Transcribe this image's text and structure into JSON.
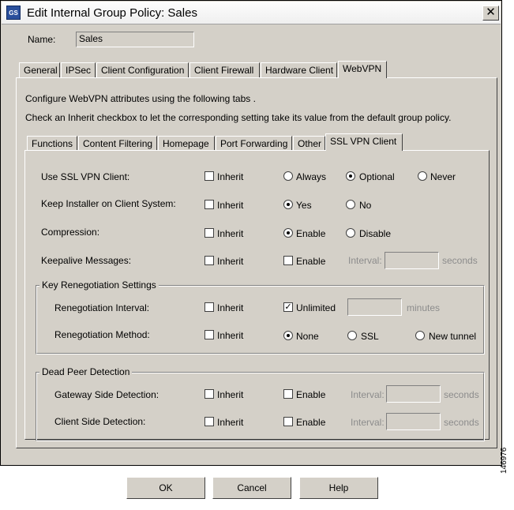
{
  "window": {
    "title": "Edit Internal Group Policy: Sales",
    "app_icon_text": "GS",
    "close_symbol": "✕"
  },
  "name_field": {
    "label": "Name:",
    "value": "Sales"
  },
  "main_tabs": [
    {
      "label": "General"
    },
    {
      "label": "IPSec"
    },
    {
      "label": "Client Configuration"
    },
    {
      "label": "Client Firewall"
    },
    {
      "label": "Hardware Client"
    },
    {
      "label": "WebVPN",
      "active": true
    }
  ],
  "description": {
    "line1": "Configure WebVPN attributes using the following tabs .",
    "line2": "Check an Inherit checkbox to let the corresponding setting take its value from the default group policy."
  },
  "sub_tabs": [
    {
      "label": "Functions"
    },
    {
      "label": "Content Filtering"
    },
    {
      "label": "Homepage"
    },
    {
      "label": "Port Forwarding"
    },
    {
      "label": "Other"
    },
    {
      "label": "SSL VPN Client",
      "active": true
    }
  ],
  "inherit_label": "Inherit",
  "settings": {
    "use_ssl_vpn_client": {
      "label": "Use SSL VPN Client:",
      "inherit": false,
      "options": [
        "Always",
        "Optional",
        "Never"
      ],
      "selected": "Optional"
    },
    "keep_installer": {
      "label": "Keep Installer on Client System:",
      "inherit": false,
      "options": [
        "Yes",
        "No"
      ],
      "selected": "Yes"
    },
    "compression": {
      "label": "Compression:",
      "inherit": false,
      "options": [
        "Enable",
        "Disable"
      ],
      "selected": "Enable"
    },
    "keepalive": {
      "label": "Keepalive Messages:",
      "inherit": false,
      "enable_label": "Enable",
      "enabled": false,
      "interval_label": "Interval:",
      "interval_value": "",
      "unit": "seconds"
    }
  },
  "key_renegotiation": {
    "title": "Key Renegotiation Settings",
    "interval": {
      "label": "Renegotiation Interval:",
      "inherit": false,
      "unlimited_label": "Unlimited",
      "unlimited": true,
      "value": "",
      "unit": "minutes"
    },
    "method": {
      "label": "Renegotiation Method:",
      "inherit": false,
      "options": [
        "None",
        "SSL",
        "New tunnel"
      ],
      "selected": "None"
    }
  },
  "dead_peer_detection": {
    "title": "Dead Peer Detection",
    "gateway": {
      "label": "Gateway Side Detection:",
      "inherit": false,
      "enable_label": "Enable",
      "enabled": false,
      "interval_label": "Interval:",
      "interval_value": "",
      "unit": "seconds"
    },
    "client": {
      "label": "Client Side Detection:",
      "inherit": false,
      "enable_label": "Enable",
      "enabled": false,
      "interval_label": "Interval:",
      "interval_value": "",
      "unit": "seconds"
    }
  },
  "buttons": {
    "ok": "OK",
    "cancel": "Cancel",
    "help": "Help"
  },
  "figure_id": "146976"
}
